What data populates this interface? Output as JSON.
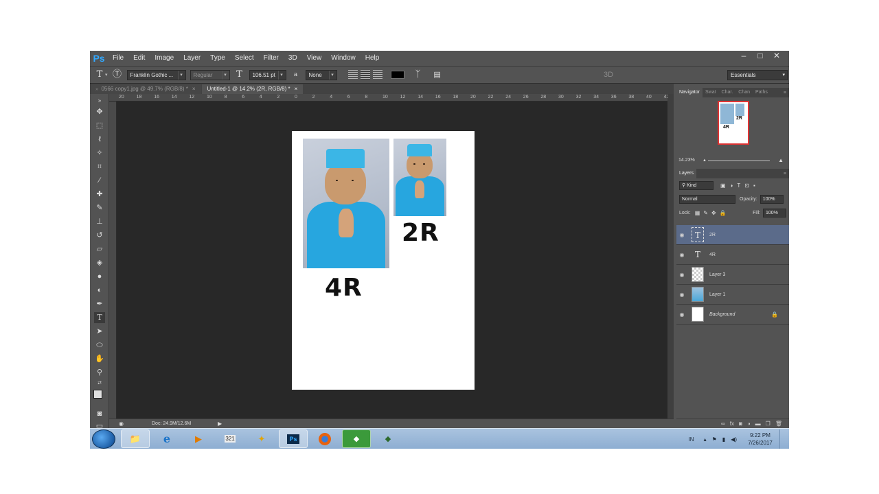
{
  "app": {
    "logo": "Ps"
  },
  "menu": [
    "File",
    "Edit",
    "Image",
    "Layer",
    "Type",
    "Select",
    "Filter",
    "3D",
    "View",
    "Window",
    "Help"
  ],
  "window_controls": [
    "–",
    "□",
    "✕"
  ],
  "options": {
    "tool_icon": "T",
    "font_family": "Franklin Gothic ...",
    "font_style": "Regular",
    "font_size": "106.51 pt",
    "antialias_icon": "a",
    "antialias": "None",
    "color": "#000000",
    "three_d": "3D",
    "workspace": "Essentials"
  },
  "tabs": [
    {
      "label": "0566 copy1.jpg @ 49.7% (RGB/8) *",
      "close": "×"
    },
    {
      "label": "Untitled-1 @ 14.2% (2R, RGB/8) *",
      "close": "×"
    }
  ],
  "ruler_ticks": [
    "20",
    "18",
    "16",
    "14",
    "12",
    "10",
    "8",
    "6",
    "4",
    "2",
    "0",
    "2",
    "4",
    "6",
    "8",
    "10",
    "12",
    "14",
    "16",
    "18",
    "20",
    "22",
    "24",
    "26",
    "28",
    "30",
    "32",
    "34",
    "36",
    "38",
    "40",
    "42"
  ],
  "document": {
    "label_4r": "4R",
    "label_2r": "2R"
  },
  "status": {
    "doc": "Doc: 24.9M/12.6M"
  },
  "panels": {
    "nav_tabs": [
      "Navigator",
      "Swat",
      "Char.",
      "Chan",
      "Paths"
    ],
    "zoom": "14.23%",
    "layers_tab": "Layers",
    "filter_kind": "Kind",
    "blend_mode": "Normal",
    "opacity_label": "Opacity:",
    "opacity": "100%",
    "lock_label": "Lock:",
    "fill_label": "Fill:",
    "fill": "100%",
    "layers": [
      {
        "name": "2R",
        "type": "text",
        "selected": true
      },
      {
        "name": "4R",
        "type": "text",
        "selected": false
      },
      {
        "name": "Layer 3",
        "type": "image",
        "selected": false
      },
      {
        "name": "Layer 1",
        "type": "image",
        "selected": false
      },
      {
        "name": "Background",
        "type": "background",
        "selected": false
      }
    ]
  },
  "taskbar": {
    "lang": "IN",
    "time": "9:22 PM",
    "date": "7/26/2017",
    "apps": [
      "explorer-icon",
      "internet-explorer-icon",
      "media-player-icon",
      "movie-icon",
      "tool-icon",
      "photoshop-icon",
      "firefox-icon",
      "game-icon",
      "game2-icon"
    ]
  },
  "colors": {
    "accent": "#31a8ff",
    "photo_shirt": "#27a6df",
    "layer_selected": "#5b6b8a"
  }
}
